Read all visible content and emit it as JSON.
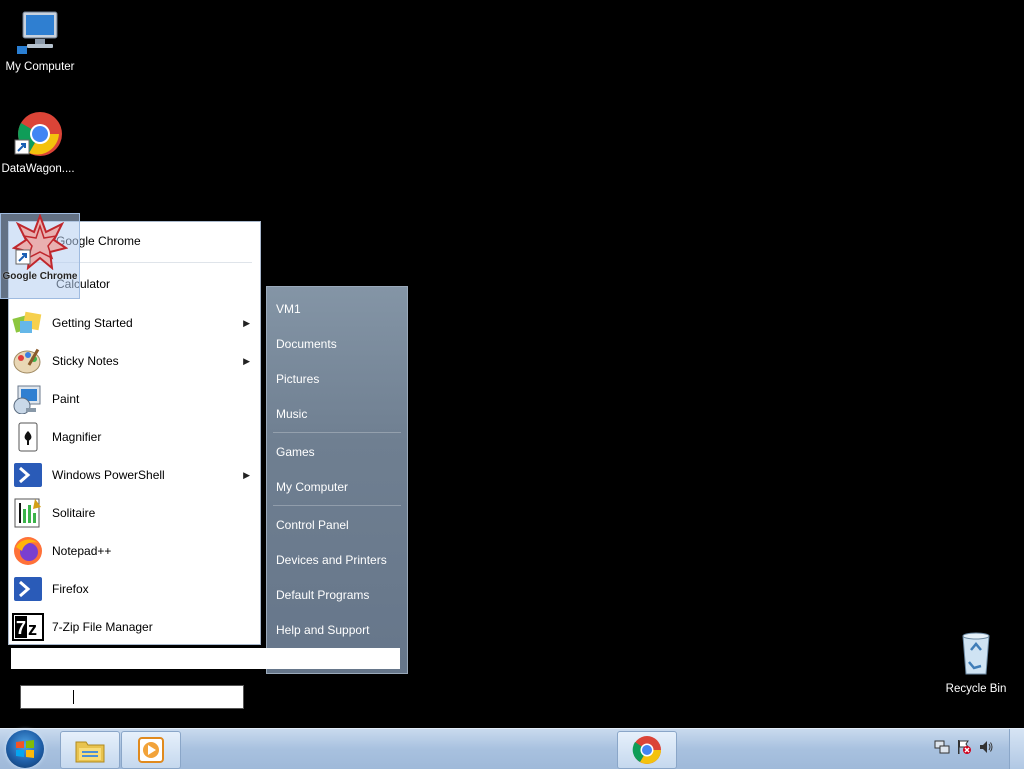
{
  "desktop": {
    "icons": [
      {
        "label": "My Computer",
        "icon": "computer-icon"
      },
      {
        "label": "DataWagon....",
        "icon": "chrome-icon"
      },
      {
        "label": "Recycle Bin",
        "icon": "recycle-bin-icon"
      }
    ],
    "dragged_icon": {
      "label": "Google Chrome",
      "icon": "wolfram-star-icon"
    }
  },
  "start_menu": {
    "pinned": [
      {
        "label": "Google Chrome",
        "icon": "chrome-icon"
      },
      {
        "label": "Calculator",
        "icon": "calculator-icon"
      }
    ],
    "programs": [
      {
        "label": "Getting Started",
        "icon": "getting-started-icon",
        "submenu": true
      },
      {
        "label": "Sticky Notes",
        "icon": "sticky-notes-icon",
        "submenu": true
      },
      {
        "label": "Paint",
        "icon": "paint-icon",
        "submenu": false
      },
      {
        "label": "Magnifier",
        "icon": "magnifier-icon",
        "submenu": false
      },
      {
        "label": "Windows PowerShell",
        "icon": "powershell-icon",
        "submenu": true
      },
      {
        "label": "Solitaire",
        "icon": "solitaire-icon",
        "submenu": false
      },
      {
        "label": "Notepad++",
        "icon": "notepadpp-icon",
        "submenu": false
      },
      {
        "label": "Firefox",
        "icon": "firefox-icon",
        "submenu": false
      },
      {
        "label": "7-Zip File Manager",
        "icon": "sevenzip-icon",
        "submenu": false
      }
    ],
    "right_pane": [
      {
        "label": "VM1"
      },
      {
        "label": "Documents"
      },
      {
        "label": "Pictures"
      },
      {
        "label": "Music"
      },
      {
        "label": "Games"
      },
      {
        "label": "My Computer"
      },
      {
        "label": "Control Panel"
      },
      {
        "label": "Devices and Printers"
      },
      {
        "label": "Default Programs"
      },
      {
        "label": "Help and Support"
      }
    ],
    "search": {
      "value": ""
    }
  },
  "text_input": {
    "value": ""
  },
  "taskbar": {
    "buttons": [
      {
        "name": "explorer",
        "icon": "folder-icon"
      },
      {
        "name": "media-player",
        "icon": "media-player-icon"
      },
      {
        "name": "chrome",
        "icon": "chrome-icon"
      }
    ],
    "tray": [
      "network-icon",
      "action-center-flag-icon",
      "volume-icon"
    ]
  }
}
